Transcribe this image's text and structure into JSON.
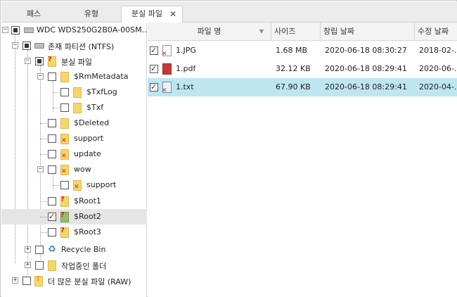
{
  "tabs": [
    {
      "label": "패스"
    },
    {
      "label": "유형"
    },
    {
      "label": "분실 파일",
      "active": true
    }
  ],
  "tree": {
    "items": [
      {
        "label": "WDC  WDS250G2B0A-00SM...",
        "icon": "disk-icon",
        "expander": "−",
        "checkbox": "partial"
      },
      {
        "label": "존재 파티션 (NTFS)",
        "icon": "partition-icon",
        "expander": "−",
        "checkbox": "partial"
      },
      {
        "label": "분실 파일",
        "icon": "lost-folder-icon",
        "expander": "−",
        "checkbox": "partial"
      },
      {
        "label": "$RmMetadata",
        "icon": "folder-icon",
        "expander": "−",
        "checkbox": "unchecked"
      },
      {
        "label": "$TxfLog",
        "icon": "folder-icon",
        "expander": "",
        "checkbox": "unchecked"
      },
      {
        "label": "$Txf",
        "icon": "folder-icon",
        "expander": "",
        "checkbox": "unchecked"
      },
      {
        "label": "$Deleted",
        "icon": "folder-icon",
        "expander": "",
        "checkbox": "unchecked"
      },
      {
        "label": "support",
        "icon": "deleted-folder-icon",
        "expander": "",
        "checkbox": "unchecked"
      },
      {
        "label": "update",
        "icon": "deleted-folder-icon",
        "expander": "",
        "checkbox": "unchecked"
      },
      {
        "label": "wow",
        "icon": "deleted-folder-icon",
        "expander": "−",
        "checkbox": "unchecked"
      },
      {
        "label": "support",
        "icon": "deleted-folder-icon",
        "expander": "",
        "checkbox": "unchecked"
      },
      {
        "label": "$Root1",
        "icon": "lost-folder-icon",
        "expander": "",
        "checkbox": "unchecked"
      },
      {
        "label": "$Root2",
        "icon": "lost-folder-icon",
        "expander": "",
        "checkbox": "checked",
        "selected": true
      },
      {
        "label": "$Root3",
        "icon": "lost-folder-icon",
        "expander": "",
        "checkbox": "unchecked"
      },
      {
        "label": "Recycle Bin",
        "icon": "recycle-bin-icon",
        "expander": "+",
        "checkbox": "unchecked"
      },
      {
        "label": "작업중인 폴더",
        "icon": "folder-icon",
        "expander": "+",
        "checkbox": "unchecked"
      },
      {
        "label": "더 많은 분실 파일 (RAW)",
        "icon": "raw-files-icon",
        "expander": "+",
        "checkbox": "unchecked"
      }
    ]
  },
  "list": {
    "columns": [
      "파일 명",
      "사이즈",
      "창립 날짜",
      "수정 날짜"
    ],
    "rows": [
      {
        "name": "1.JPG",
        "size": "1.68 MB",
        "created": "2020-06-18 08:30:27",
        "modified": "2018-02-...",
        "type": "jpg-file-icon",
        "checked": true
      },
      {
        "name": "1.pdf",
        "size": "32.12 KB",
        "created": "2020-06-18 08:29:41",
        "modified": "2020-06-...",
        "type": "pdf-file-icon",
        "checked": true
      },
      {
        "name": "1.txt",
        "size": "67.90 KB",
        "created": "2020-06-18 08:29:41",
        "modified": "2020-04-...",
        "type": "txt-file-icon",
        "checked": true,
        "selected": true
      }
    ]
  },
  "colors": {
    "selected_row": "#bfe6f0",
    "tree_selected": "#e5e5e5",
    "folder": "#f6d66a",
    "deleted_mark": "#dd2211"
  }
}
